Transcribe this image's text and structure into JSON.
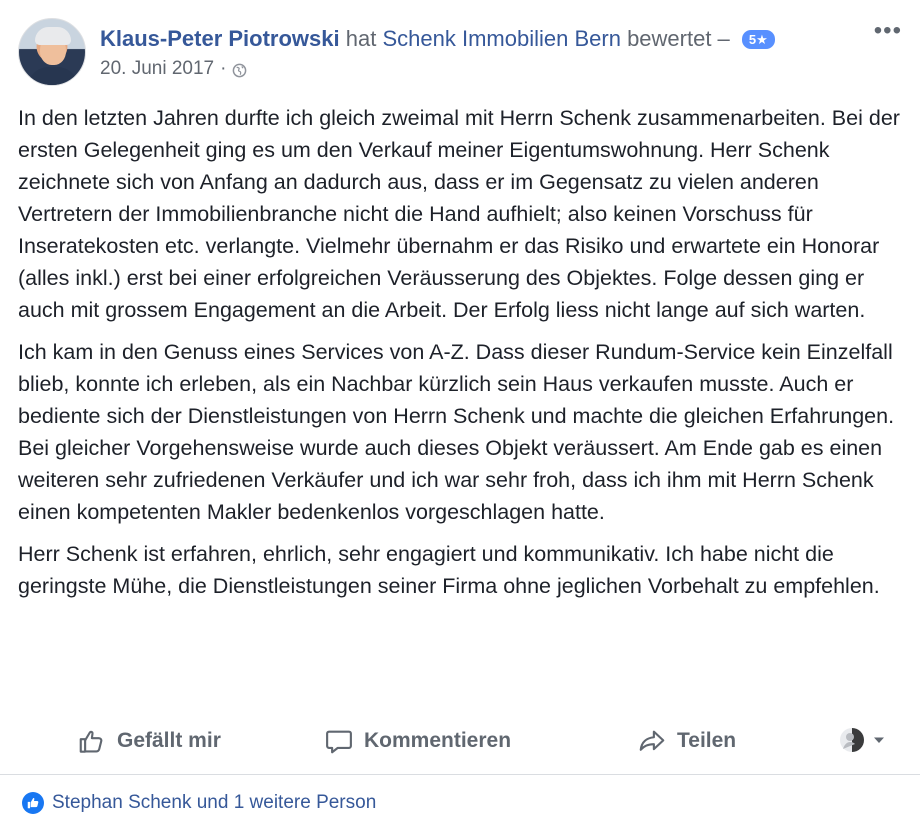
{
  "post": {
    "author": "Klaus-Peter Piotrowski",
    "verb": "hat",
    "page": "Schenk Immobilien Bern",
    "verb2": "bewertet –",
    "rating": "5★",
    "date": "20. Juni 2017",
    "separator": "·",
    "more": "•••"
  },
  "paragraphs": [
    "In den letzten Jahren durfte ich gleich zweimal mit Herrn Schenk zusammenarbeiten. Bei der ersten Gelegenheit ging es um den Verkauf meiner Eigentumswohnung. Herr Schenk zeichnete sich von Anfang an dadurch aus, dass er im Gegensatz zu vielen anderen Vertretern der Immobilienbranche nicht die Hand aufhielt; also keinen Vorschuss für Inseratekosten etc. verlangte. Vielmehr übernahm er das Risiko und erwartete ein Honorar (alles inkl.) erst bei einer erfolgreichen Veräusserung des Objektes. Folge dessen ging er auch mit grossem Engagement an die Arbeit. Der Erfolg liess nicht lange auf sich warten.",
    "Ich kam in den Genuss eines Services von A-Z. Dass dieser Rundum-Service kein Einzelfall blieb, konnte ich erleben, als ein Nachbar kürzlich sein Haus verkaufen musste. Auch er bediente sich der Dienstleistungen von Herrn Schenk und machte die gleichen Erfahrungen. Bei gleicher Vorgehensweise wurde auch dieses Objekt veräussert. Am Ende gab es einen weiteren sehr zufriedenen Verkäufer und ich war sehr froh, dass ich ihm mit Herrn Schenk einen kompetenten Makler bedenkenlos vorgeschlagen hatte.",
    "Herr Schenk ist erfahren, ehrlich, sehr engagiert und kommunikativ. Ich habe nicht die geringste Mühe, die Dienstleistungen seiner Firma ohne jeglichen Vorbehalt zu empfehlen."
  ],
  "actions": {
    "like": "Gefällt mir",
    "comment": "Kommentieren",
    "share": "Teilen"
  },
  "reactions": {
    "text": "Stephan Schenk und 1 weitere Person"
  },
  "icons": {
    "like": "thumbs-up-icon",
    "comment": "speech-bubble-icon",
    "share": "share-arrow-icon",
    "audience": "avatar-dropdown-icon",
    "globe": "globe-icon",
    "more": "more-dots-icon"
  },
  "colors": {
    "link": "#365899",
    "muted": "#606770",
    "accent": "#5890ff",
    "like": "#1877f2"
  }
}
